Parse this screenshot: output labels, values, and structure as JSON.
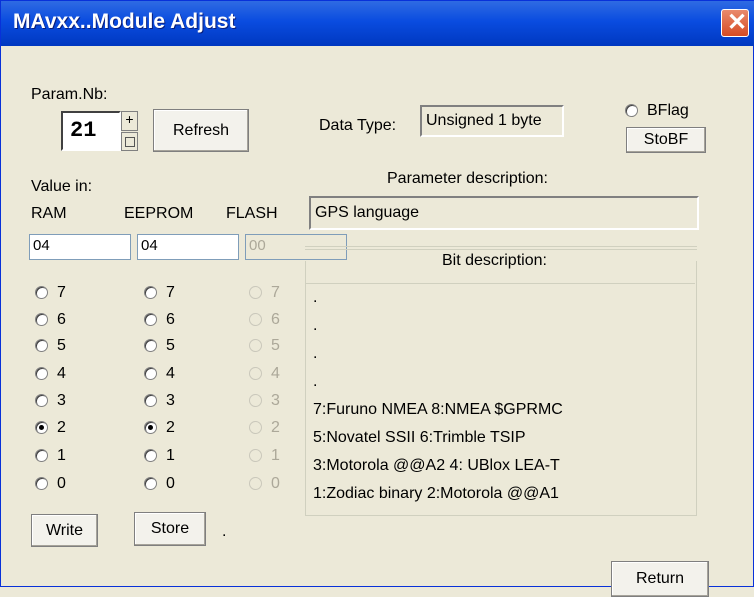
{
  "window": {
    "title": "MAvxx..Module Adjust",
    "close_glyph": "✕"
  },
  "param": {
    "label": "Param.Nb:",
    "value": "21",
    "plus": "+",
    "refresh_label": "Refresh"
  },
  "data_type": {
    "label": "Data Type:",
    "value": "Unsigned 1 byte"
  },
  "bflag": {
    "label": "BFlag",
    "stobf_label": "StoBF"
  },
  "value_in": {
    "label": "Value in:",
    "ram_label": "RAM",
    "eeprom_label": "EEPROM",
    "flash_label": "FLASH",
    "ram_value": "04",
    "eeprom_value": "04",
    "flash_value": "00"
  },
  "param_desc": {
    "label": "Parameter description:",
    "value": "GPS language"
  },
  "bit_desc": {
    "label": "Bit description:",
    "lines": [
      ".",
      ".",
      ".",
      ".",
      "7:Furuno NMEA 8:NMEA $GPRMC",
      "5:Novatel SSII 6:Trimble TSIP",
      "3:Motorola @@A2 4: UBlox LEA-T",
      "1:Zodiac binary 2:Motorola @@A1"
    ]
  },
  "bits": {
    "labels": [
      "7",
      "6",
      "5",
      "4",
      "3",
      "2",
      "1",
      "0"
    ],
    "ram_selected": "2",
    "eeprom_selected": "2"
  },
  "buttons": {
    "write": "Write",
    "store": "Store",
    "dot": ".",
    "return": "Return"
  }
}
